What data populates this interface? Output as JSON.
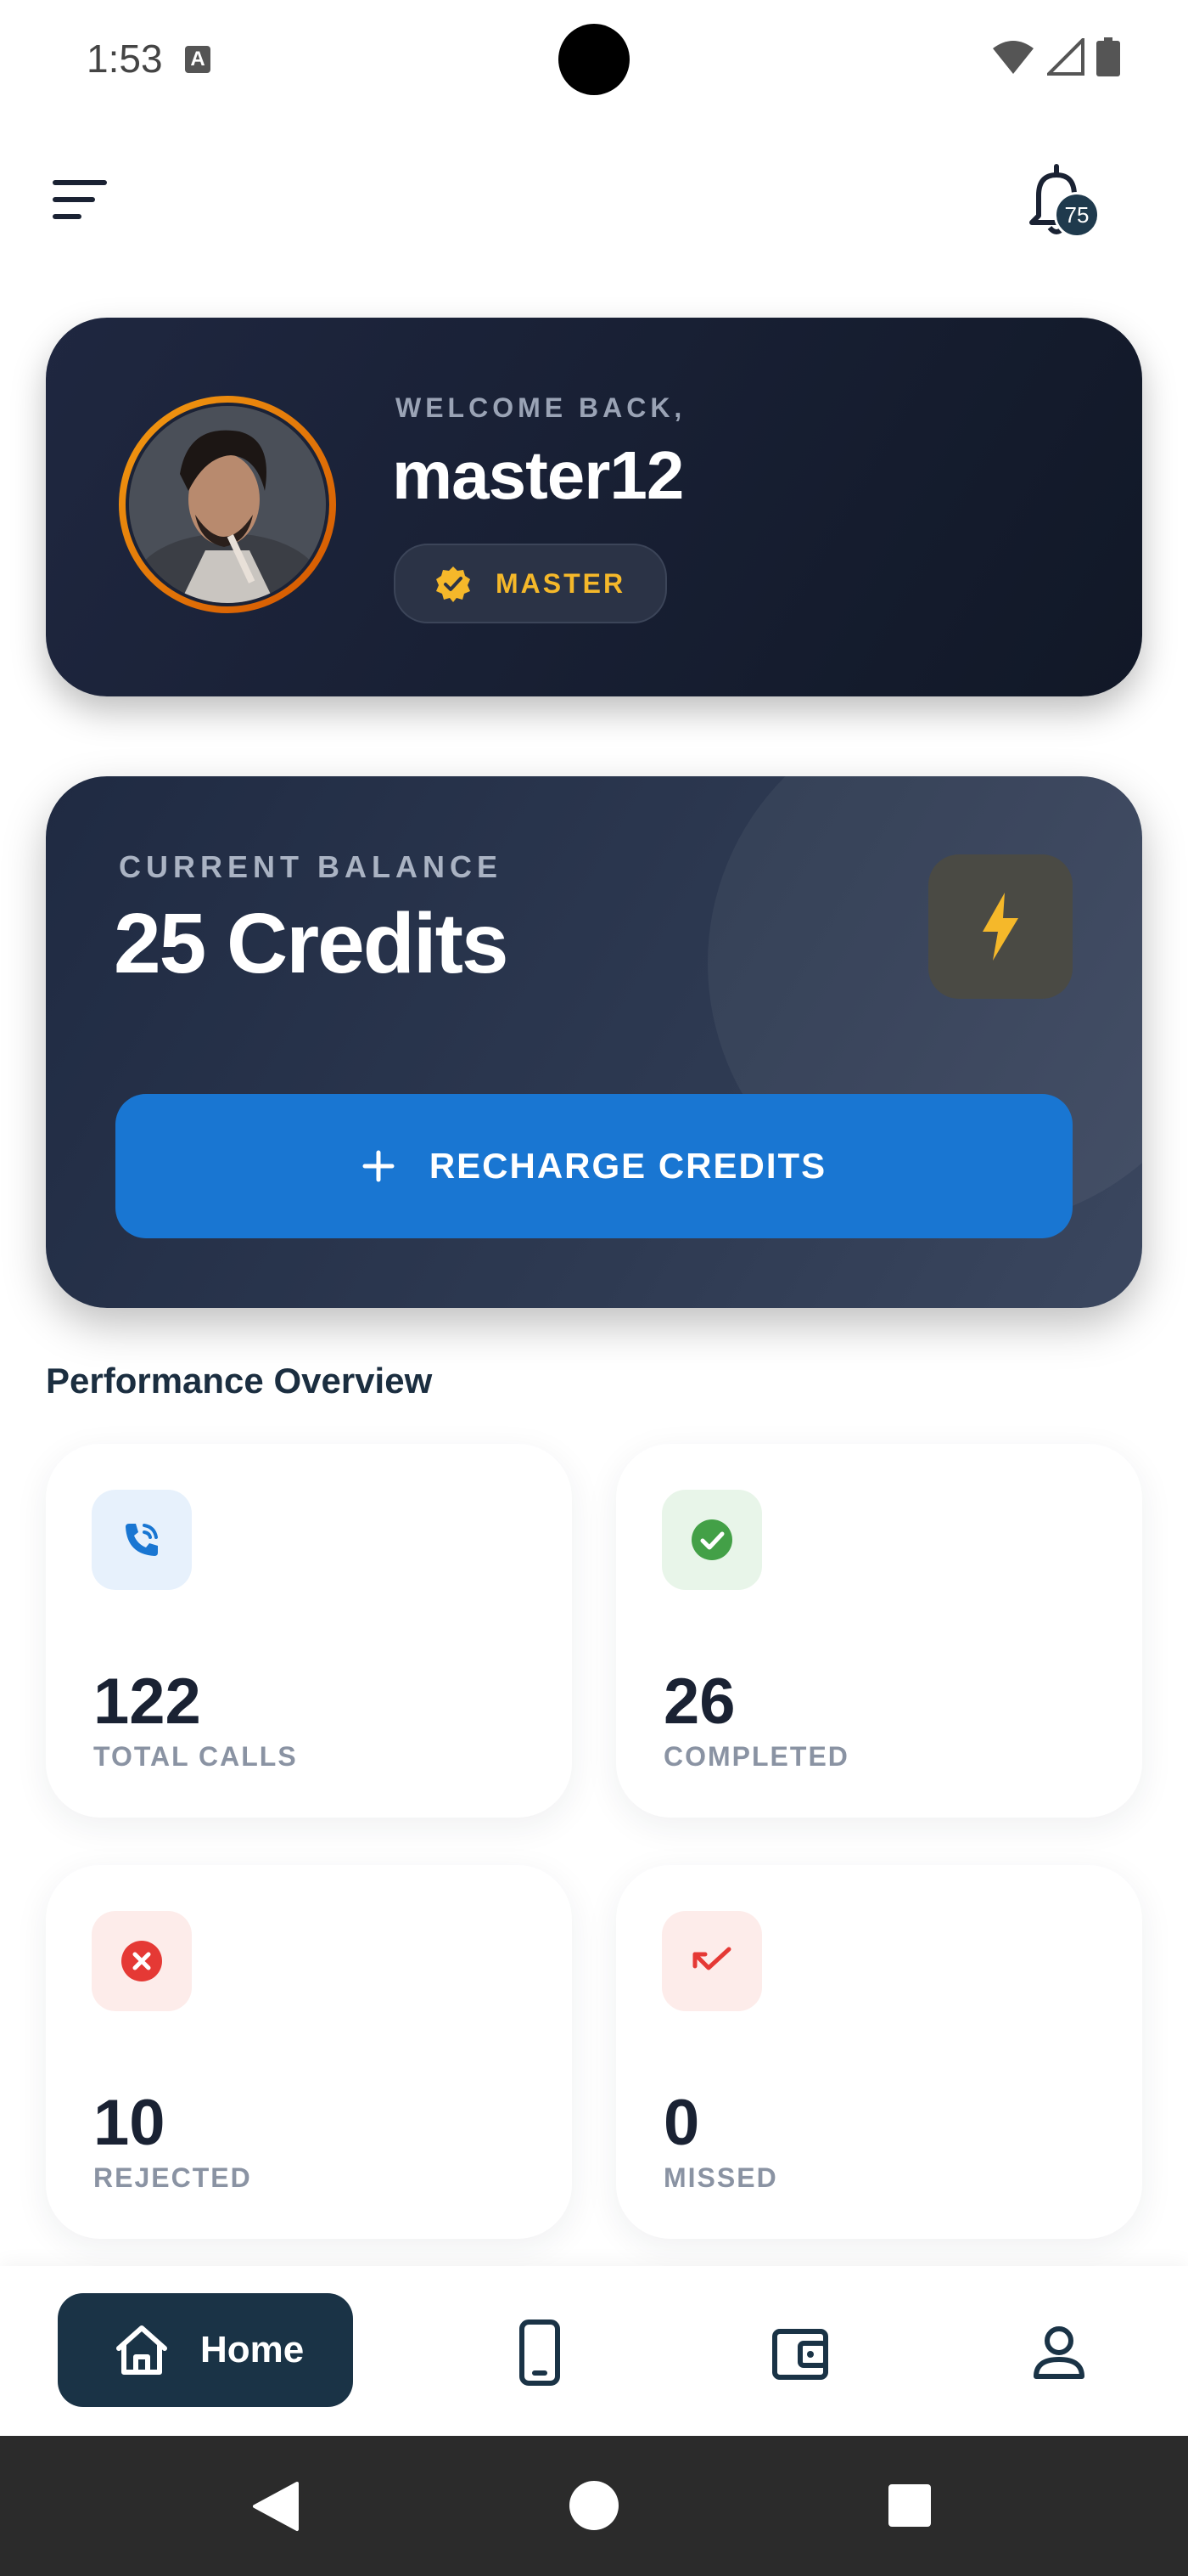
{
  "status_bar": {
    "time": "1:53",
    "a_icon": "A"
  },
  "header": {
    "notification_count": "75"
  },
  "welcome": {
    "label": "WELCOME BACK,",
    "username": "master12",
    "rank": "MASTER"
  },
  "balance": {
    "label": "CURRENT BALANCE",
    "value": "25 Credits",
    "recharge_label": "RECHARGE CREDITS"
  },
  "performance": {
    "title": "Performance Overview",
    "stats": [
      {
        "value": "122",
        "label": "TOTAL CALLS"
      },
      {
        "value": "26",
        "label": "COMPLETED"
      },
      {
        "value": "10",
        "label": "REJECTED"
      },
      {
        "value": "0",
        "label": "MISSED"
      }
    ]
  },
  "nav": {
    "home_label": "Home"
  },
  "colors": {
    "accent": "#1976d2",
    "card_dark": "#111827",
    "gold": "#f5b82a",
    "nav_active": "#1a3346"
  },
  "icons": [
    "menu-icon",
    "bell-icon",
    "verified-icon",
    "bolt-icon",
    "plus-icon",
    "phone-call-icon",
    "check-circle-icon",
    "cancel-icon",
    "missed-call-icon",
    "home-icon",
    "phone-icon",
    "wallet-icon",
    "profile-icon"
  ]
}
